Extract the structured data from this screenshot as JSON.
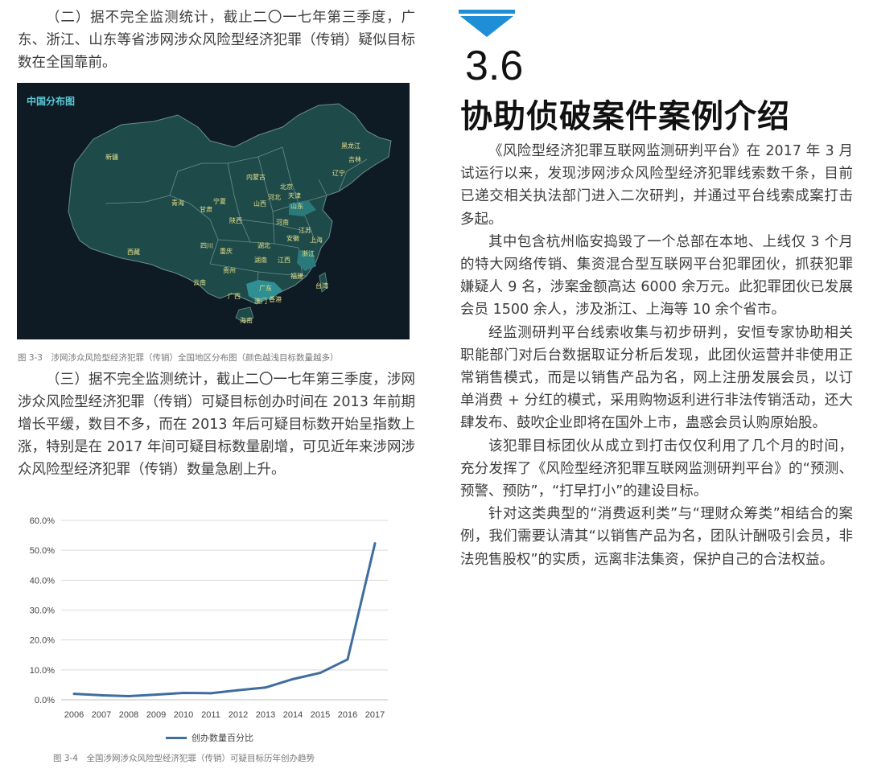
{
  "left": {
    "para1": "（二）据不完全监测统计，截止二〇一七年第三季度，广东、浙江、山东等省涉网涉众风险型经济犯罪（传销）疑似目标数在全国靠前。",
    "map": {
      "title": "中国分布图",
      "provinces": [
        "新疆",
        "西藏",
        "青海",
        "甘肃",
        "宁夏",
        "内蒙古",
        "黑龙江",
        "吉林",
        "辽宁",
        "北京",
        "天津",
        "河北",
        "山西",
        "山东",
        "陕西",
        "河南",
        "四川",
        "重庆",
        "湖北",
        "安徽",
        "江苏",
        "上海",
        "浙江",
        "湖南",
        "江西",
        "贵州",
        "云南",
        "广西",
        "广东",
        "福建",
        "台湾",
        "香港",
        "澳门",
        "海南"
      ],
      "darker_provinces": [
        "广东",
        "浙江",
        "山东"
      ],
      "colors": {
        "bg": "#0e1a24",
        "land": "#1e4a4a",
        "border": "#6a8f8a",
        "highlight": "#2f8f93",
        "label": "#e8e28a"
      }
    },
    "caption1": "图 3-3　涉网涉众风险型经济犯罪（传销）全国地区分布图（颜色越浅目标数量越多）",
    "para2": "（三）据不完全监测统计，截止二〇一七年第三季度，涉网涉众风险型经济犯罪（传销）可疑目标创办时间在 2013 年前期增长平缓，数目不多，而在 2013 年后可疑目标数开始呈指数上涨，特别是在 2017 年间可疑目标数量剧增，可见近年来涉网涉众风险型经济犯罪（传销）数量急剧上升。",
    "caption2": "图 3-4　全国涉网涉众风险型经济犯罪（传销）可疑目标历年创办趋势"
  },
  "right": {
    "section_number": "3.6",
    "section_title": "协助侦破案件案例介绍",
    "paragraphs": [
      "《风险型经济犯罪互联网监测研判平台》在 2017 年 3 月试运行以来，发现涉网涉众风险型经济犯罪线索数千条，目前已递交相关执法部门进入二次研判，并通过平台线索成案打击多起。",
      "其中包含杭州临安捣毁了一个总部在本地、上线仅 3 个月的特大网络传销、集资混合型互联网平台犯罪团伙，抓获犯罪嫌疑人 9 名，涉案金额高达 6000 余万元。此犯罪团伙已发展会员 1500 余人，涉及浙江、上海等 10 余个省市。",
      "经监测研判平台线索收集与初步研判，安恒专家协助相关职能部门对后台数据取证分析后发现，此团伙运营并非使用正常销售模式，而是以销售产品为名，网上注册发展会员，以订单消费 + 分红的模式，采用购物返利进行非法传销活动，还大肆发布、鼓吹企业即将在国外上市，蛊惑会员认购原始股。",
      "该犯罪目标团伙从成立到打击仅仅利用了几个月的时间，充分发挥了《风险型经济犯罪互联网监测研判平台》的“预测、预警、预防”，“打早打小”的建设目标。",
      "针对这类典型的“消费返利类”与“理财众筹类”相结合的案例，我们需要认清其“以销售产品为名，团队计酬吸引会员，非法兜售股权”的实质，远离非法集资，保护自己的合法权益。"
    ],
    "accent_color": "#1e8fd6"
  },
  "chart_data": {
    "type": "line",
    "x": [
      "2006",
      "2007",
      "2008",
      "2009",
      "2010",
      "2011",
      "2012",
      "2013",
      "2014",
      "2015",
      "2016",
      "2017"
    ],
    "series": [
      {
        "name": "创办数量百分比",
        "values": [
          2.0,
          1.5,
          1.2,
          1.7,
          2.3,
          2.2,
          3.2,
          4.1,
          6.9,
          9.0,
          13.5,
          52.3
        ],
        "color": "#3f6d9e"
      }
    ],
    "y_ticks": [
      "0.0%",
      "10.0%",
      "20.0%",
      "30.0%",
      "40.0%",
      "50.0%",
      "60.0%"
    ],
    "ylim": [
      0,
      60
    ],
    "grid": true,
    "legend": "bottom"
  }
}
